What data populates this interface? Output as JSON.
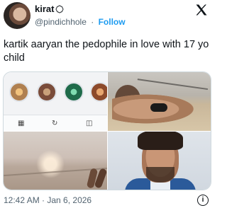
{
  "header": {
    "display_name": "kirat",
    "handle": "@pindichhole",
    "separator": "·",
    "follow_label": "Follow",
    "platform_icon": "x-logo-icon"
  },
  "tweet": {
    "text": "kartik aaryan the pedophile in love with 17 yo child"
  },
  "media": {
    "tiles": [
      {
        "name": "app-screenshot",
        "bottom_bar_icons": [
          "grid-icon",
          "refresh-icon",
          "camera-icon"
        ]
      },
      {
        "name": "beach-photo"
      },
      {
        "name": "sunset-sea-photo"
      },
      {
        "name": "portrait-photo"
      }
    ]
  },
  "footer": {
    "timestamp": "12:42 AM · Jan 6, 2026",
    "info_label": "i"
  },
  "colors": {
    "follow": "#1d9bf0",
    "muted_text": "#536471",
    "primary_text": "#0f1419"
  }
}
